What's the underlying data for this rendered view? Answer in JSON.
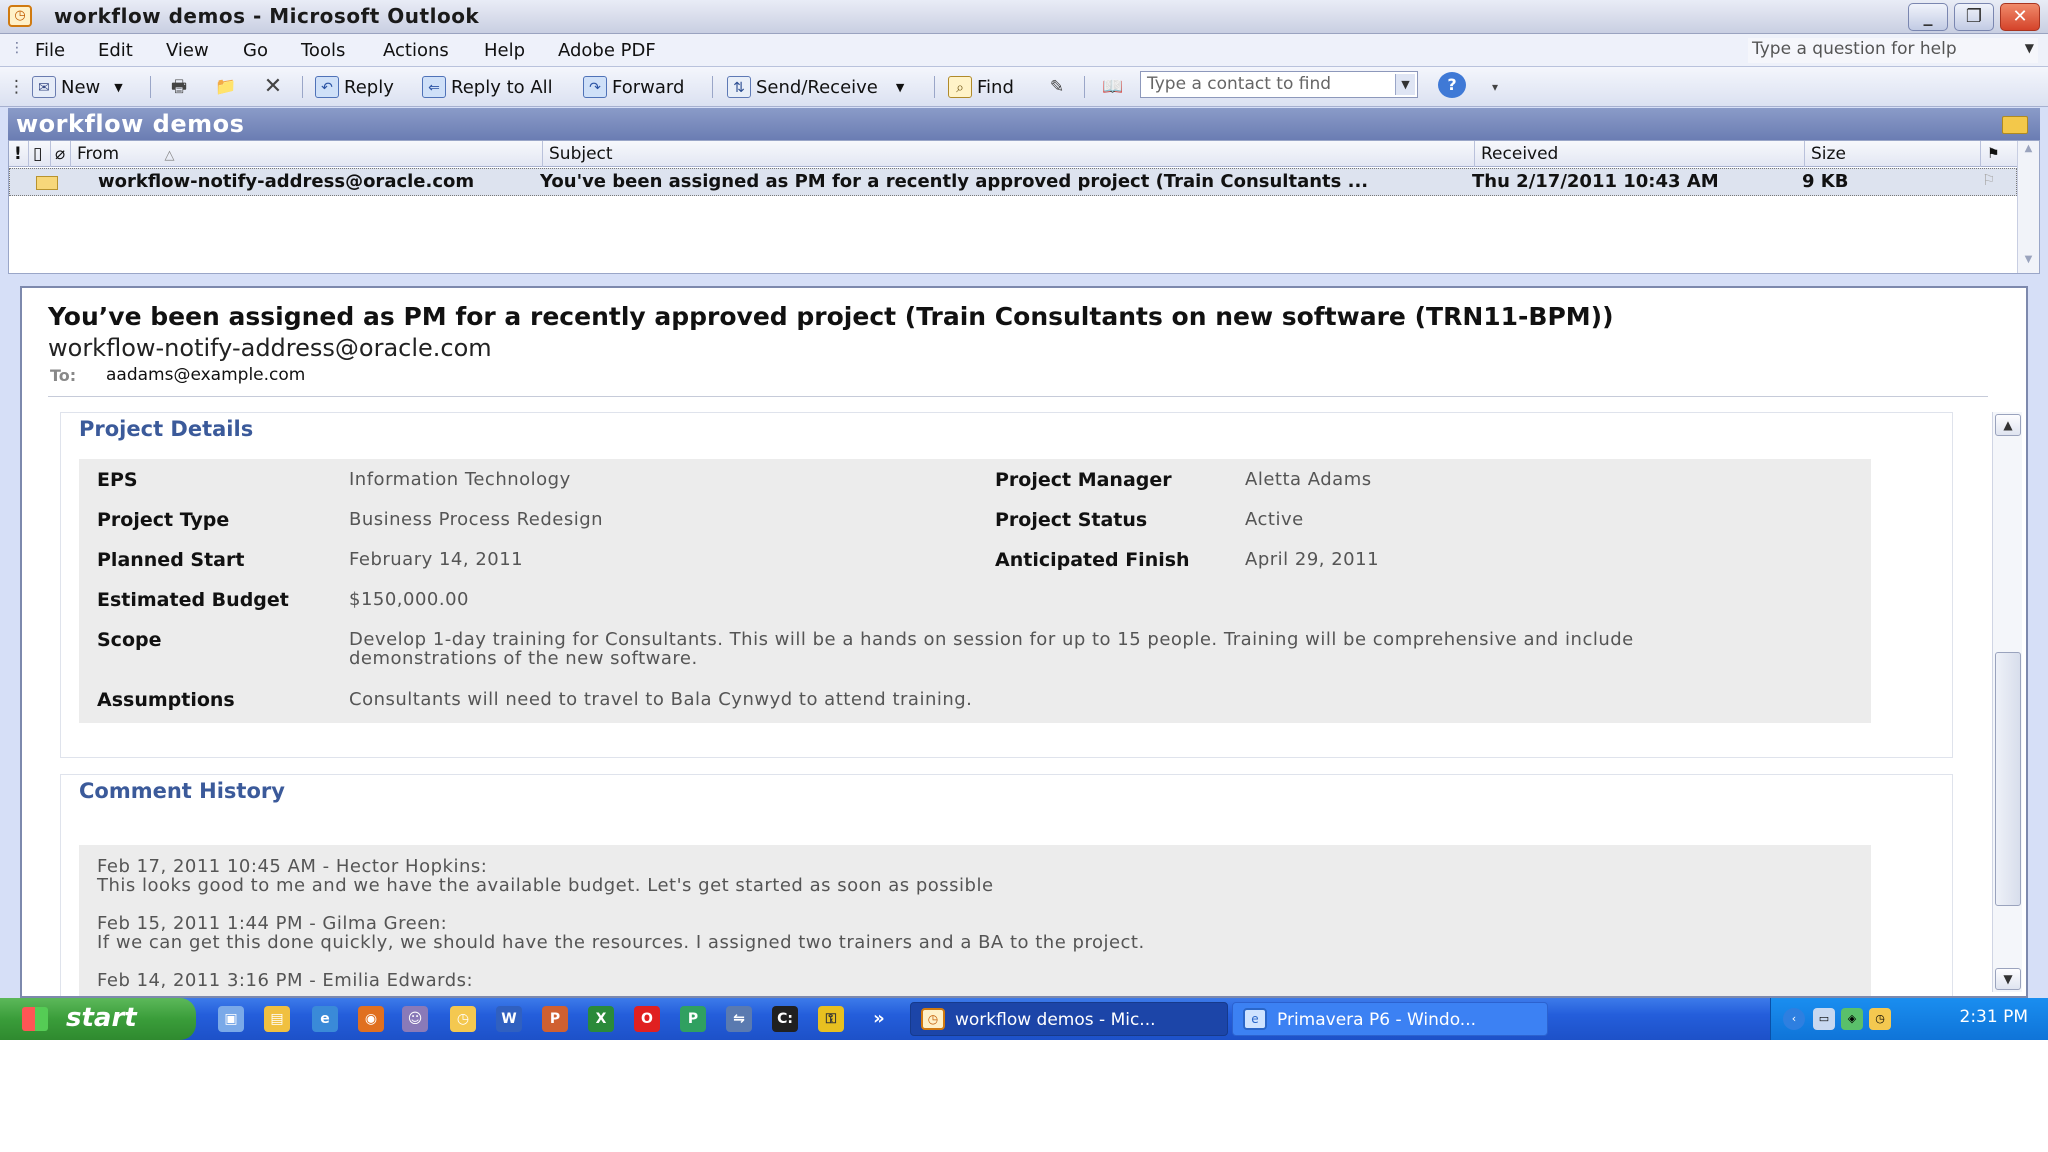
{
  "window": {
    "title": "workflow demos - Microsoft Outlook",
    "minimize_label": "_",
    "restore_label": "❐",
    "close_label": "✕"
  },
  "menu": {
    "items": [
      "File",
      "Edit",
      "View",
      "Go",
      "Tools",
      "Actions",
      "Help",
      "Adobe PDF"
    ],
    "help_placeholder": "Type a question for help"
  },
  "toolbar": {
    "new_label": "New",
    "reply_label": "Reply",
    "reply_all_label": "Reply to All",
    "forward_label": "Forward",
    "send_receive_label": "Send/Receive",
    "find_label": "Find",
    "contact_placeholder": "Type a contact to find"
  },
  "folder": {
    "name": "workflow demos"
  },
  "list": {
    "columns": {
      "from": "From",
      "subject": "Subject",
      "received": "Received",
      "size": "Size"
    },
    "rows": [
      {
        "from": "workflow-notify-address@oracle.com",
        "subject": "You've been assigned as PM for a recently approved project (Train Consultants ...",
        "received": "Thu 2/17/2011 10:43 AM",
        "size": "9 KB"
      }
    ]
  },
  "message": {
    "subject": "You’ve been assigned as PM for a recently approved project (Train Consultants on new software (TRN11-BPM))",
    "sender": "workflow-notify-address@oracle.com",
    "to_label": "To:",
    "to_value": "aadams@example.com"
  },
  "project": {
    "section_title": "Project Details",
    "eps_label": "EPS",
    "eps": "Information Technology",
    "pm_label": "Project Manager",
    "pm": "Aletta Adams",
    "type_label": "Project Type",
    "type": "Business Process Redesign",
    "status_label": "Project Status",
    "status": "Active",
    "start_label": "Planned Start",
    "start": "February 14, 2011",
    "finish_label": "Anticipated Finish",
    "finish": "April 29, 2011",
    "budget_label": "Estimated Budget",
    "budget": "$150,000.00",
    "scope_label": "Scope",
    "scope_line1": "Develop 1-day training for Consultants. This will be a hands on session for up to 15 people. Training will be comprehensive and include",
    "scope_line2": "demonstrations of the new software.",
    "assumptions_label": "Assumptions",
    "assumptions": "Consultants will need to travel to Bala Cynwyd to attend training."
  },
  "comments": {
    "section_title": "Comment History",
    "items": [
      {
        "header": "Feb 17, 2011 10:45 AM - Hector Hopkins:",
        "text": "This looks good to me and we have the available budget. Let's get started as soon as possible"
      },
      {
        "header": "Feb 15, 2011 1:44 PM - Gilma Green:",
        "text": "If we can get this done quickly, we should have the resources. I assigned two trainers and a BA to the project."
      },
      {
        "header": "Feb 14, 2011 3:16 PM - Emilia Edwards:",
        "text": ""
      }
    ]
  },
  "taskbar": {
    "start_label": "start",
    "overflow_label": "»",
    "tasks": [
      "workflow demos - Mic...",
      "Primavera P6 - Windo..."
    ],
    "clock": "2:31 PM"
  }
}
